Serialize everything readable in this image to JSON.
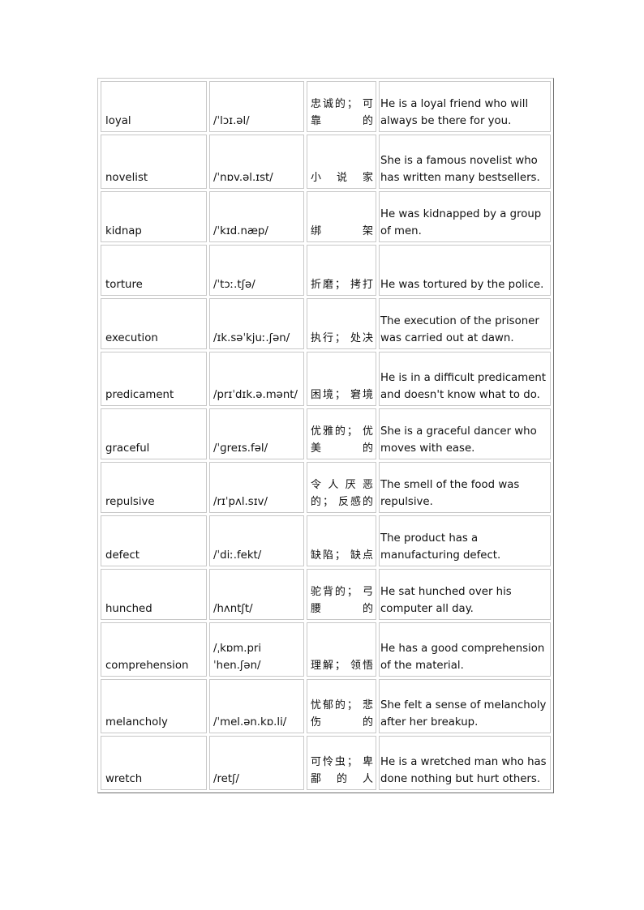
{
  "table": {
    "rows": [
      {
        "word": "loyal",
        "ipa": "/ˈlɔɪ.əl/",
        "chinese": "忠诚的； 可靠的",
        "example": "He is a loyal friend who will always be there for you."
      },
      {
        "word": "novelist",
        "ipa": "/ˈnɒv.əl.ɪst/",
        "chinese": "小说家",
        "example": "She is a famous novelist who has written many bestsellers."
      },
      {
        "word": "kidnap",
        "ipa": "/ˈkɪd.næp/",
        "chinese": "绑架",
        "example": "He was kidnapped by a group of men."
      },
      {
        "word": "torture",
        "ipa": "/ˈtɔː.tʃə/",
        "chinese": "折磨； 拷打",
        "example": "He was tortured by the police."
      },
      {
        "word": "execution",
        "ipa": "/ɪk.səˈkjuː.ʃən/",
        "chinese": "执行； 处决",
        "example": "The execution of the prisoner was carried out at dawn."
      },
      {
        "word": "predicament",
        "ipa": "/prɪˈdɪk.ə.mənt/",
        "chinese": "困境； 窘境",
        "example": "He is in a difficult predicament and doesn't know what to do."
      },
      {
        "word": "graceful",
        "ipa": "/ˈɡreɪs.fəl/",
        "chinese": "优雅的； 优美的",
        "example": "She is a graceful dancer who moves with ease."
      },
      {
        "word": "repulsive",
        "ipa": "/rɪˈpʌl.sɪv/",
        "chinese": "令人厌恶的； 反感的",
        "example": "The smell of the food was repulsive."
      },
      {
        "word": "defect",
        "ipa": "/ˈdiː.fekt/",
        "chinese": "缺陷； 缺点",
        "example": "The product has a manufacturing defect."
      },
      {
        "word": "hunched",
        "ipa": "/hʌntʃt/",
        "chinese": "驼背的； 弓腰的",
        "example": "He sat hunched over his computer all day."
      },
      {
        "word": "comprehension",
        "ipa": "/ˌkɒm.priˈhen.ʃən/",
        "chinese": "理解； 领悟",
        "example": "He has a good comprehension of the material."
      },
      {
        "word": "melancholy",
        "ipa": "/ˈmel.ən.kɒ.li/",
        "chinese": "忧郁的； 悲伤的",
        "example": "She felt a sense of melancholy after her breakup."
      },
      {
        "word": "wretch",
        "ipa": "/retʃ/",
        "chinese": "可怜虫； 卑鄙的人",
        "example": "He is a wretched man who has done nothing but hurt others."
      }
    ]
  }
}
